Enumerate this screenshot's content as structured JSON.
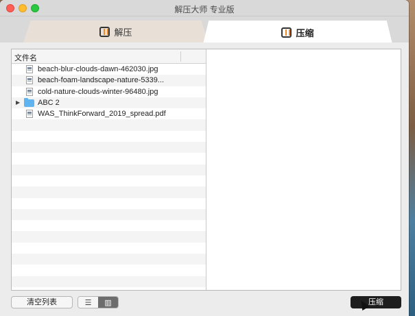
{
  "window": {
    "title": "解压大师 专业版"
  },
  "tabs": [
    {
      "label": "解压",
      "icon": "extract-icon",
      "active": false
    },
    {
      "label": "压缩",
      "icon": "compress-icon",
      "active": true
    }
  ],
  "file_list": {
    "header": "文件名",
    "rows": [
      {
        "name": "beach-blur-clouds-dawn-462030.jpg",
        "type": "image-file-icon"
      },
      {
        "name": "beach-foam-landscape-nature-5339...",
        "type": "image-file-icon"
      },
      {
        "name": "cold-nature-clouds-winter-96480.jpg",
        "type": "image-file-icon"
      },
      {
        "name": "ABC 2",
        "type": "folder-icon"
      },
      {
        "name": "WAS_ThinkForward_2019_spread.pdf",
        "type": "pdf-file-icon"
      }
    ]
  },
  "bottombar": {
    "clear_label": "清空列表",
    "compress_label": "压缩"
  },
  "colors": {
    "accent": "#f08a24",
    "folder": "#5fb4ef",
    "primary_button": "#1e1e1e"
  }
}
